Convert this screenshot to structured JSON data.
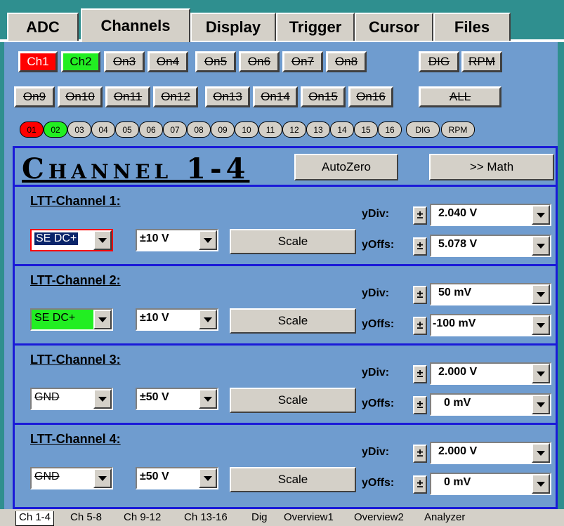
{
  "top_tabs": [
    "ADC",
    "Channels",
    "Display",
    "Trigger",
    "Cursor",
    "Files"
  ],
  "channel_buttons_row1": [
    "Ch1",
    "Ch2",
    "On3",
    "On4",
    "On5",
    "On6",
    "On7",
    "On8",
    "DIG",
    "RPM"
  ],
  "channel_buttons_row2": [
    "On9",
    "On10",
    "On11",
    "On12",
    "On13",
    "On14",
    "On15",
    "On16",
    "ALL"
  ],
  "pills": [
    "01",
    "02",
    "03",
    "04",
    "05",
    "06",
    "07",
    "08",
    "09",
    "10",
    "11",
    "12",
    "13",
    "14",
    "15",
    "16",
    "DIG",
    "RPM"
  ],
  "title": "Channel 1-4",
  "autozero": "AutoZero",
  "math": ">> Math",
  "channels": [
    {
      "label": "LTT-Channel 1:",
      "coupling": "SE DC+",
      "range": "±10 V",
      "scale": "Scale",
      "ydiv_label": "yDiv:",
      "ydiv": "2.040 V",
      "yoffs_label": "yOffs:",
      "yoffs": "5.078 V"
    },
    {
      "label": "LTT-Channel 2:",
      "coupling": "SE DC+",
      "range": "±10 V",
      "scale": "Scale",
      "ydiv_label": "yDiv:",
      "ydiv": "50 mV",
      "yoffs_label": "yOffs:",
      "yoffs": "-100 mV"
    },
    {
      "label": "LTT-Channel 3:",
      "coupling": "GND",
      "range": "±50 V",
      "scale": "Scale",
      "ydiv_label": "yDiv:",
      "ydiv": "2.000 V",
      "yoffs_label": "yOffs:",
      "yoffs": "0 mV"
    },
    {
      "label": "LTT-Channel 4:",
      "coupling": "GND",
      "range": "±50 V",
      "scale": "Scale",
      "ydiv_label": "yDiv:",
      "ydiv": "2.000 V",
      "yoffs_label": "yOffs:",
      "yoffs": "0 mV"
    }
  ],
  "pm": "±",
  "bottom_tabs": [
    "Ch 1-4",
    "Ch 5-8",
    "Ch 9-12",
    "Ch 13-16",
    "Dig",
    "Overview1",
    "Overview2",
    "Analyzer"
  ],
  "colors": {
    "ch1": "#ff0000",
    "ch2": "#22ee22",
    "panel": "#6f9ccf",
    "border": "#1a1ad8"
  }
}
